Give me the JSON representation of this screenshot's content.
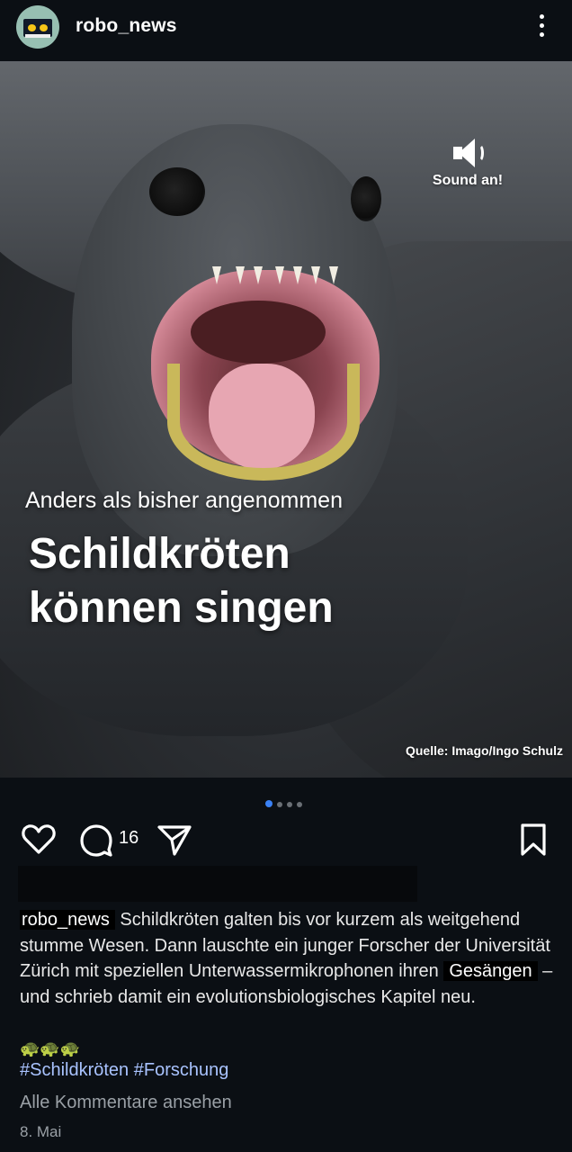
{
  "header": {
    "username": "robo_news",
    "avatar_icon": "robot-avatar-icon",
    "more_icon": "more-vertical-icon"
  },
  "post_image": {
    "sound_label": "Sound an!",
    "sound_icon": "speaker-icon",
    "kicker": "Anders als bisher angenommen",
    "headline_line1": "Schildkröten",
    "headline_line2": "können singen",
    "source": "Quelle: Imago/Ingo Schulz"
  },
  "carousel": {
    "count": 4,
    "active_index": 0,
    "active_color": "#3b82f6"
  },
  "actions": {
    "like_icon": "heart-icon",
    "comment_icon": "comment-icon",
    "comment_count": "16",
    "share_icon": "send-icon",
    "save_icon": "bookmark-icon"
  },
  "caption": {
    "username": "robo_news",
    "text_part1": " Schildkröten galten bis vor kurzem als weitgehend stumme Wesen. Dann lauschte ein junger Forscher der Universität Zürich mit speziellen Unterwassermikrophonen ihren ",
    "highlight": "Gesängen",
    "text_part2": " – und schrieb damit ein evolutionsbiologisches Kapitel neu.",
    "emojis": "🐢🐢🐢",
    "hashtags": "#Schildkröten #Forschung"
  },
  "footer": {
    "all_comments": "Alle Kommentare ansehen",
    "date": "8. Mai"
  }
}
